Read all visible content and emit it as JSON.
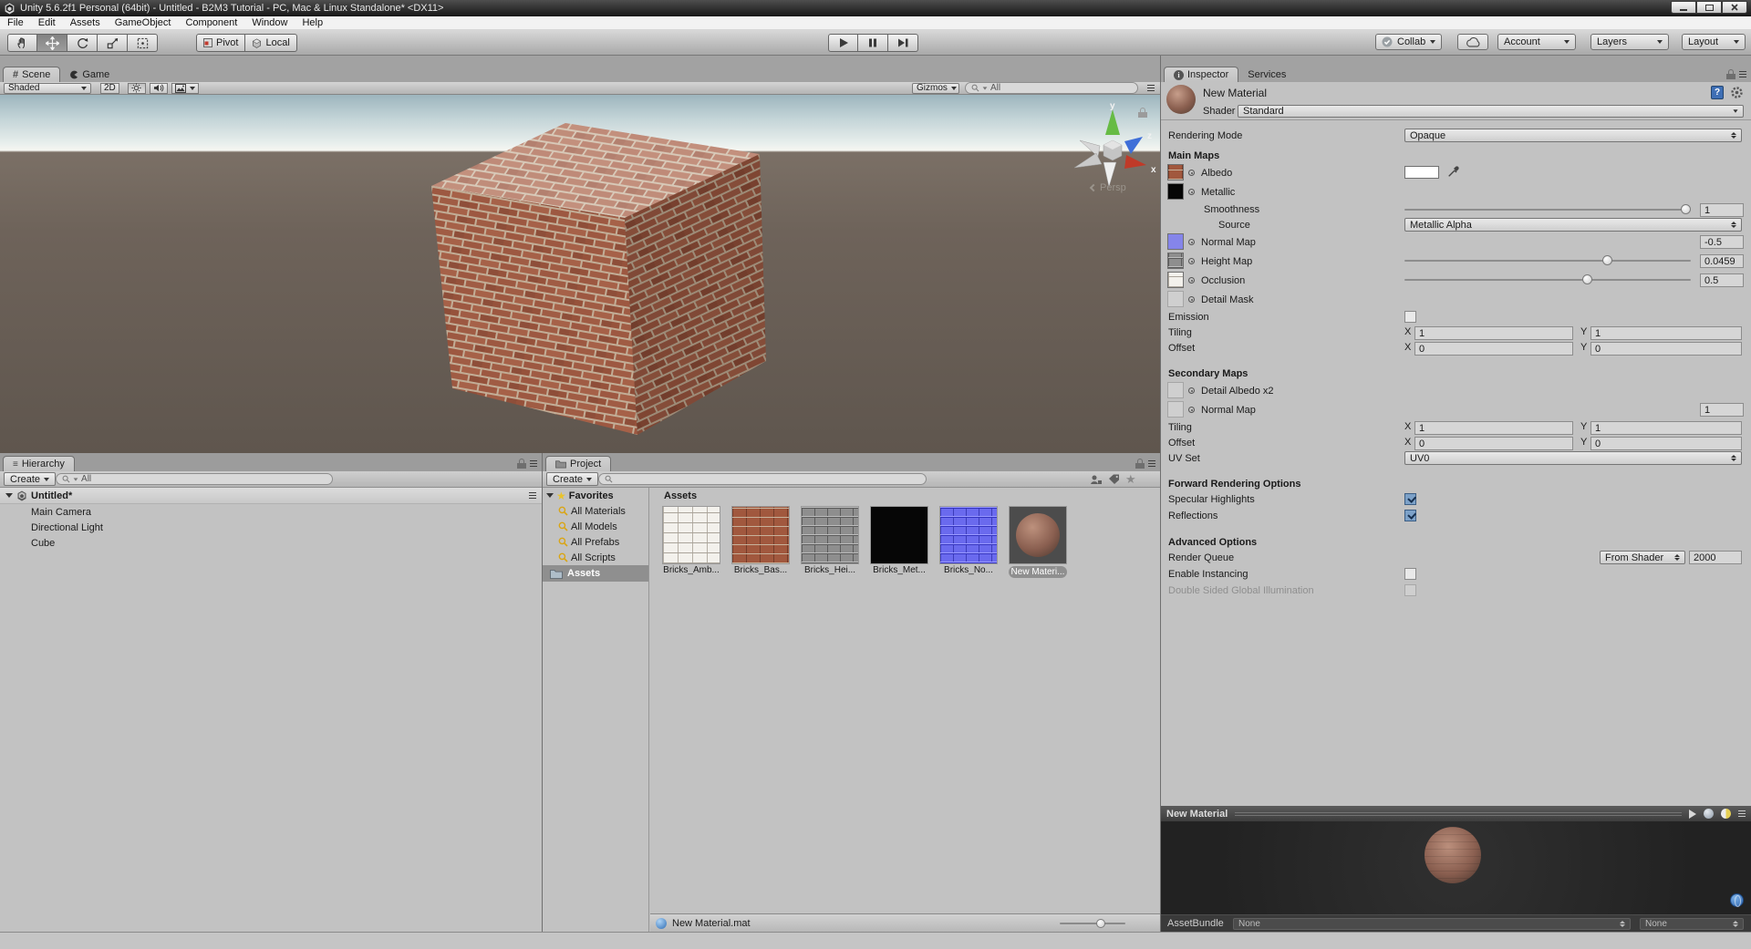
{
  "window": {
    "title": "Unity 5.6.2f1 Personal (64bit) - Untitled - B2M3 Tutorial - PC, Mac & Linux Standalone* <DX11>"
  },
  "menu": {
    "items": [
      "File",
      "Edit",
      "Assets",
      "GameObject",
      "Component",
      "Window",
      "Help"
    ]
  },
  "toolbar": {
    "pivot": "Pivot",
    "local": "Local",
    "collab": "Collab",
    "account": "Account",
    "layers": "Layers",
    "layout": "Layout"
  },
  "scene_view": {
    "tab_scene": "Scene",
    "tab_game": "Game",
    "shading": "Shaded",
    "mode_2d": "2D",
    "gizmos": "Gizmos",
    "search": "All",
    "projection": "Persp",
    "axes": {
      "x": "x",
      "y": "y",
      "z": "z"
    }
  },
  "hierarchy": {
    "tab": "Hierarchy",
    "create": "Create",
    "search": "All",
    "scene_name": "Untitled*",
    "items": [
      "Main Camera",
      "Directional Light",
      "Cube"
    ]
  },
  "project": {
    "tab": "Project",
    "create": "Create",
    "favorites": "Favorites",
    "favorite_filters": [
      "All Materials",
      "All Models",
      "All Prefabs",
      "All Scripts"
    ],
    "folder_assets": "Assets",
    "header": "Assets",
    "assets": [
      {
        "label": "Bricks_Amb..."
      },
      {
        "label": "Bricks_Bas..."
      },
      {
        "label": "Bricks_Hei..."
      },
      {
        "label": "Bricks_Met..."
      },
      {
        "label": "Bricks_No..."
      },
      {
        "label": "New Materi..."
      }
    ],
    "status_file": "New Material.mat"
  },
  "inspector": {
    "tab": "Inspector",
    "tab_services": "Services",
    "material_name": "New Material",
    "shader_label": "Shader",
    "shader": "Standard",
    "rendering_mode_label": "Rendering Mode",
    "rendering_mode": "Opaque",
    "main_maps": "Main Maps",
    "albedo": "Albedo",
    "metallic": "Metallic",
    "smoothness_label": "Smoothness",
    "smoothness": "1",
    "source_label": "Source",
    "source": "Metallic Alpha",
    "normal_map": "Normal Map",
    "normal_map_value": "-0.5",
    "height_map": "Height Map",
    "height_map_value": "0.0459",
    "occlusion": "Occlusion",
    "occlusion_value": "0.5",
    "detail_mask": "Detail Mask",
    "emission": "Emission",
    "tiling": "Tiling",
    "offset": "Offset",
    "x": "X",
    "y": "Y",
    "main_tiling_x": "1",
    "main_tiling_y": "1",
    "main_offset_x": "0",
    "main_offset_y": "0",
    "secondary_maps": "Secondary Maps",
    "detail_albedo": "Detail Albedo x2",
    "secondary_normal": "Normal Map",
    "secondary_normal_value": "1",
    "secondary_tiling_x": "1",
    "secondary_tiling_y": "1",
    "secondary_offset_x": "0",
    "secondary_offset_y": "0",
    "uv_set_label": "UV Set",
    "uv_set": "UV0",
    "forward_rendering": "Forward Rendering Options",
    "specular_highlights": "Specular Highlights",
    "reflections": "Reflections",
    "advanced": "Advanced Options",
    "render_queue_label": "Render Queue",
    "render_queue_mode": "From Shader",
    "render_queue": "2000",
    "enable_instancing": "Enable Instancing",
    "dsgi": "Double Sided Global Illumination"
  },
  "preview": {
    "title": "New Material",
    "assetbundle": "AssetBundle",
    "bundle": "None",
    "variant": "None"
  }
}
